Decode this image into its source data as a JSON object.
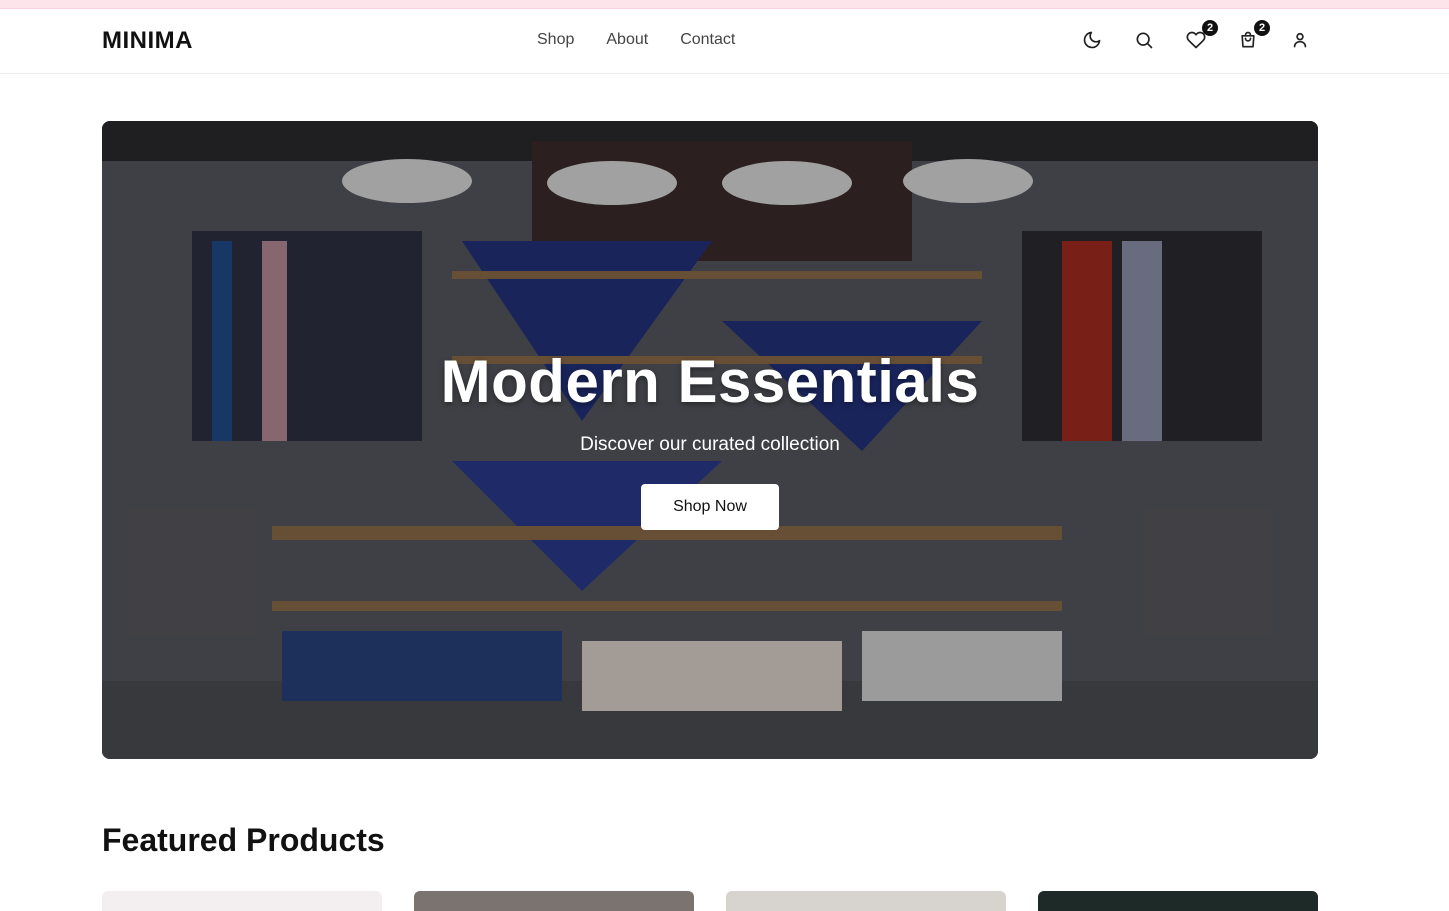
{
  "header": {
    "logo": "MINIMA",
    "nav": [
      "Shop",
      "About",
      "Contact"
    ],
    "icons": [
      {
        "name": "moon-icon",
        "badge": null
      },
      {
        "name": "search-icon",
        "badge": null
      },
      {
        "name": "heart-icon",
        "badge": "2"
      },
      {
        "name": "cart-icon",
        "badge": "2"
      },
      {
        "name": "user-icon",
        "badge": null
      }
    ]
  },
  "hero": {
    "title": "Modern Essentials",
    "subtitle": "Discover our curated collection",
    "cta": "Shop Now"
  },
  "featured": {
    "title": "Featured Products"
  }
}
